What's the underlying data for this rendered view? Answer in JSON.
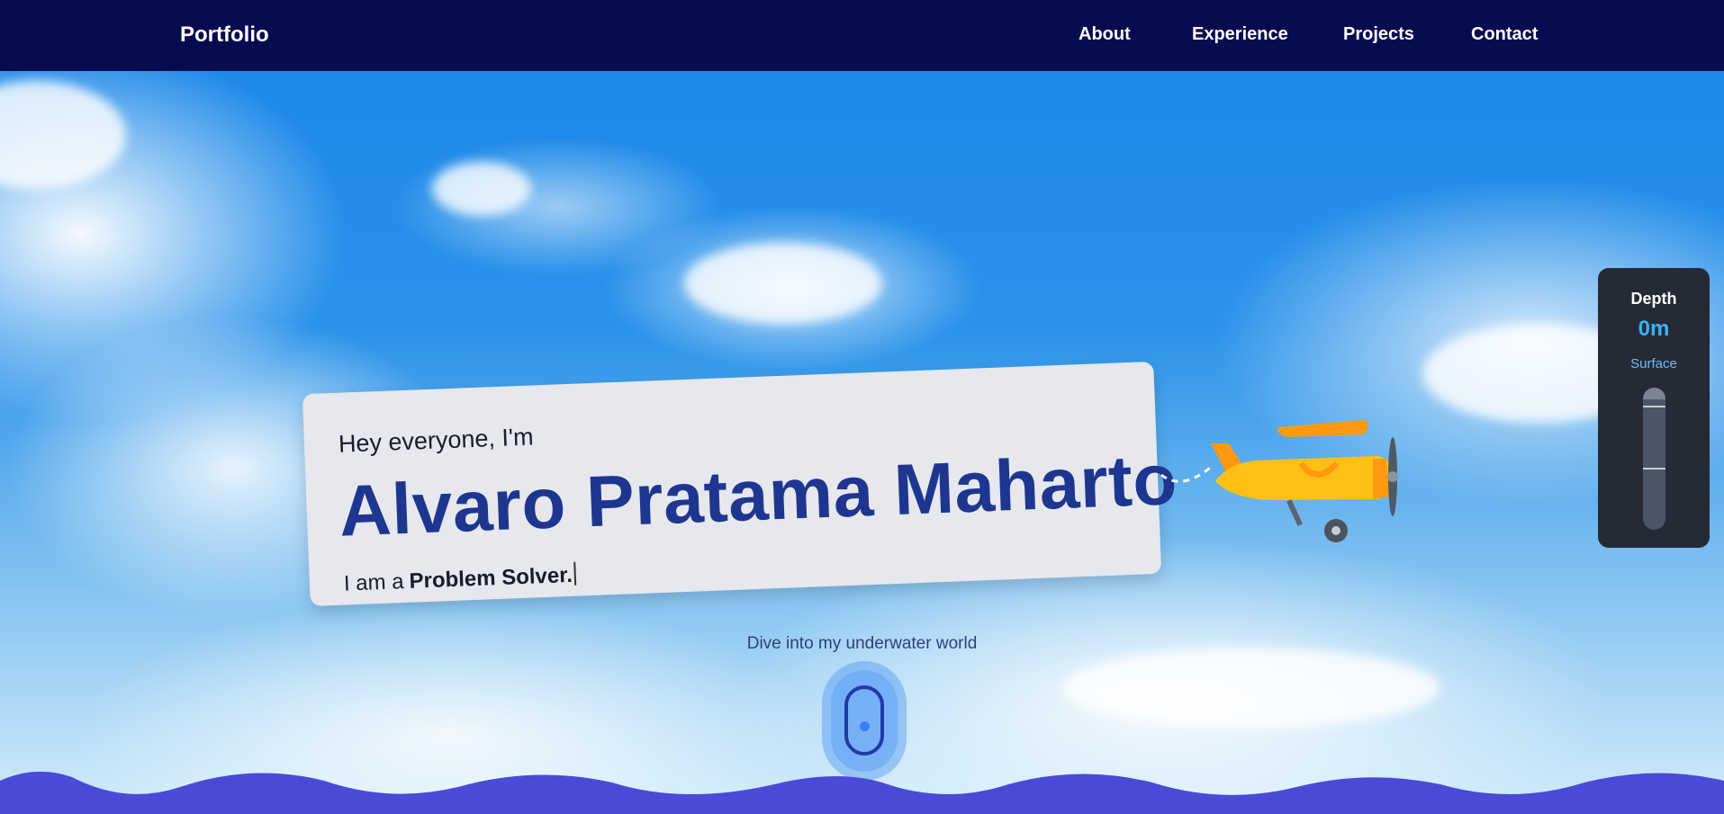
{
  "nav": {
    "brand": "Portfolio",
    "links": [
      "About",
      "Experience",
      "Projects",
      "Contact"
    ]
  },
  "hero": {
    "greeting": "Hey everyone, I'm",
    "name": "Alvaro Pratama Maharto",
    "role_prefix": "I am a",
    "role": "Problem Solver."
  },
  "depth_meter": {
    "title": "Depth",
    "value": "0m",
    "zone": "Surface",
    "level": 0
  },
  "dive": {
    "text": "Dive into my underwater world"
  },
  "icons": {
    "plane": "airplane-icon",
    "scroll": "mouse-scroll-icon"
  },
  "colors": {
    "navbar": "#070c50",
    "name": "#1f3690",
    "depth_value": "#3bb2f5",
    "waves": "#4a4ad6"
  }
}
